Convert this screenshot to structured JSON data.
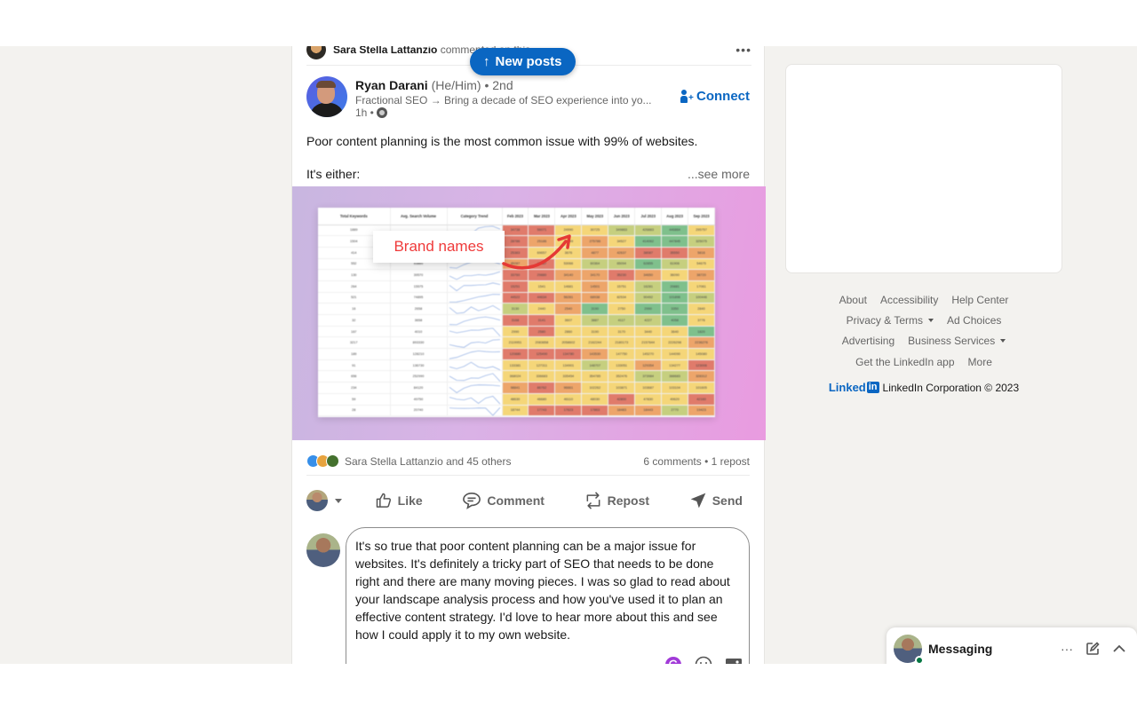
{
  "feed": {
    "context": {
      "actor": "Sara Stella Lattanzio",
      "action": "commented on this",
      "menu_icon": "more-horizontal-icon"
    },
    "new_posts_button": {
      "arrow": "↑",
      "label": "New posts"
    },
    "post": {
      "author": {
        "name": "Ryan Darani",
        "pronouns": "(He/Him)",
        "degree": "• 2nd",
        "headline": "Fractional SEO → Bring a decade of SEO experience into yo...",
        "time": "1h •",
        "visibility_icon": "globe-icon"
      },
      "connect_label": "Connect",
      "text_line1": "Poor content planning is the most common issue with 99% of websites.",
      "text_line2": "It's either:",
      "see_more": "...see more",
      "image": {
        "callout": "Brand names",
        "table": {
          "headers": [
            "Total Keywords",
            "Avg. Search Volume",
            "Category Trend",
            "Feb 2023",
            "Mar 2023",
            "Apr 2023",
            "May 2023",
            "Jun 2023",
            "Jul 2023",
            "Aug 2023",
            "Sep 2023"
          ],
          "rows": [
            {
              "kw": "1889",
              "vol": "",
              "cells": [
                "34738",
                "56071",
                "24990",
                "30725",
                "349863",
                "426883",
                "446864",
                "295757"
              ],
              "colors": "rryyllgy"
            },
            {
              "kw": "1504",
              "vol": "",
              "cells": [
                "28786",
                "25186",
                "32049",
                "275786",
                "34527",
                "414062",
                "447845",
                "325075"
              ],
              "colors": "royoyggl"
            },
            {
              "kw": "414",
              "vol": "",
              "cells": [
                "25383",
                "69657",
                "3676",
                "4877",
                "42637",
                "38087",
                "35550",
                "5816"
              ],
              "colors": "ryyoorro"
            },
            {
              "kw": "552",
              "vol": "53860",
              "cells": [
                "45287",
                "43587",
                "53066",
                "60364",
                "65094",
                "62855",
                "61906",
                "54675"
              ],
              "colors": "oryllgly"
            },
            {
              "kw": "130",
              "vol": "39570",
              "cells": [
                "33760",
                "29880",
                "34140",
                "34170",
                "35230",
                "34650",
                "36090",
                "38720"
              ],
              "colors": "rrooroyo"
            },
            {
              "kw": "264",
              "vol": "15575",
              "cells": [
                "15251",
                "1541",
                "14681",
                "14501",
                "15751",
                "16281",
                "20881",
                "17061"
              ],
              "colors": "ryyoylgy"
            },
            {
              "kw": "521",
              "vol": "74895",
              "cells": [
                "44522",
                "44634",
                "56281",
                "68938",
                "82534",
                "90492",
                "101896",
                "100446"
              ],
              "colors": "rrooylgl"
            },
            {
              "kw": "16",
              "vol": "2658",
              "cells": [
                "3130",
                "2440",
                "2540",
                "3190",
                "2750",
                "2990",
                "3350",
                "2840"
              ],
              "colors": "lyogyggy"
            },
            {
              "kw": "32",
              "vol": "3658",
              "cells": [
                "3168",
                "3141",
                "3607",
                "3887",
                "4117",
                "4227",
                "4058",
                "3776"
              ],
              "colors": "rrylllgy"
            },
            {
              "kw": "167",
              "vol": "4010",
              "cells": [
                "2990",
                "2580",
                "2860",
                "3190",
                "3170",
                "3440",
                "3640",
                "1820"
              ],
              "colors": "yryyyyyg"
            },
            {
              "kw": "3217",
              "vol": "893330",
              "cells": [
                "2119951",
                "2083658",
                "2058602",
                "2162244",
                "2180173",
                "2157644",
                "2226298",
                "2236276"
              ],
              "colors": "yyyyyyyo"
            },
            {
              "kw": "189",
              "vol": "128210",
              "cells": [
                "120880",
                "125490",
                "134780",
                "143530",
                "147750",
                "145270",
                "144090",
                "145080"
              ],
              "colors": "rrroyyyy"
            },
            {
              "kw": "91",
              "vol": "136730",
              "cells": [
                "133381",
                "127311",
                "134901",
                "148707",
                "133051",
                "129354",
                "134277",
                "123006"
              ],
              "colors": "yyylyoyr"
            },
            {
              "kw": "656",
              "vol": "252990",
              "cells": [
                "368024",
                "336683",
                "335454",
                "354785",
                "352476",
                "373984",
                "388683",
                "328312"
              ],
              "colors": "yyyyyllo"
            },
            {
              "kw": "234",
              "vol": "84120",
              "cells": [
                "98841",
                "86762",
                "96661",
                "102262",
                "103871",
                "103687",
                "103104",
                "101605"
              ],
              "colors": "oroyyyyy"
            },
            {
              "kw": "59",
              "vol": "49750",
              "cells": [
                "48630",
                "46680",
                "46110",
                "48030",
                "42800",
                "47830",
                "49620",
                "42160"
              ],
              "colors": "yyyyryyr"
            },
            {
              "kw": "28",
              "vol": "20740",
              "cells": [
                "18744",
                "17743",
                "17623",
                "17863",
                "18483",
                "18443",
                "2770",
                "19423"
              ],
              "colors": "yrrroolo"
            }
          ]
        }
      },
      "reactions": {
        "summary": "Sara Stella Lattanzio and 45 others",
        "icons": [
          "like-reaction-icon",
          "insightful-reaction-icon",
          "support-reaction-icon"
        ]
      },
      "counts": "6 comments • 1 repost",
      "actions": [
        {
          "label": "Like",
          "icon": "thumbs-up-icon"
        },
        {
          "label": "Comment",
          "icon": "comment-icon"
        },
        {
          "label": "Repost",
          "icon": "repost-icon"
        },
        {
          "label": "Send",
          "icon": "send-icon"
        }
      ],
      "comment_draft": "It's so true that poor content planning can be a major issue for websites. It's definitely a tricky part of SEO that needs to be done right and there are many moving pieces. I was so glad to read about your landscape analysis process and how you've used it to plan an effective content strategy. I'd love to hear more about this and see how I could apply it to my own website."
    }
  },
  "footer": {
    "rows": [
      [
        {
          "label": "About"
        },
        {
          "label": "Accessibility"
        },
        {
          "label": "Help Center"
        }
      ],
      [
        {
          "label": "Privacy & Terms",
          "dropdown": true
        },
        {
          "label": "Ad Choices"
        }
      ],
      [
        {
          "label": "Advertising"
        },
        {
          "label": "Business Services",
          "dropdown": true
        }
      ],
      [
        {
          "label": "Get the LinkedIn app"
        },
        {
          "label": "More"
        }
      ]
    ],
    "logo_word": "Linked",
    "logo_in": "in",
    "copyright": "LinkedIn Corporation © 2023"
  },
  "messaging": {
    "label": "Messaging",
    "more": "···",
    "compose_icon": "compose-icon",
    "collapse_icon": "chevron-up-icon"
  },
  "colors": {
    "accent": "#0a66c2",
    "callout_red": "#ef3a3a",
    "presence_green": "#057642"
  }
}
